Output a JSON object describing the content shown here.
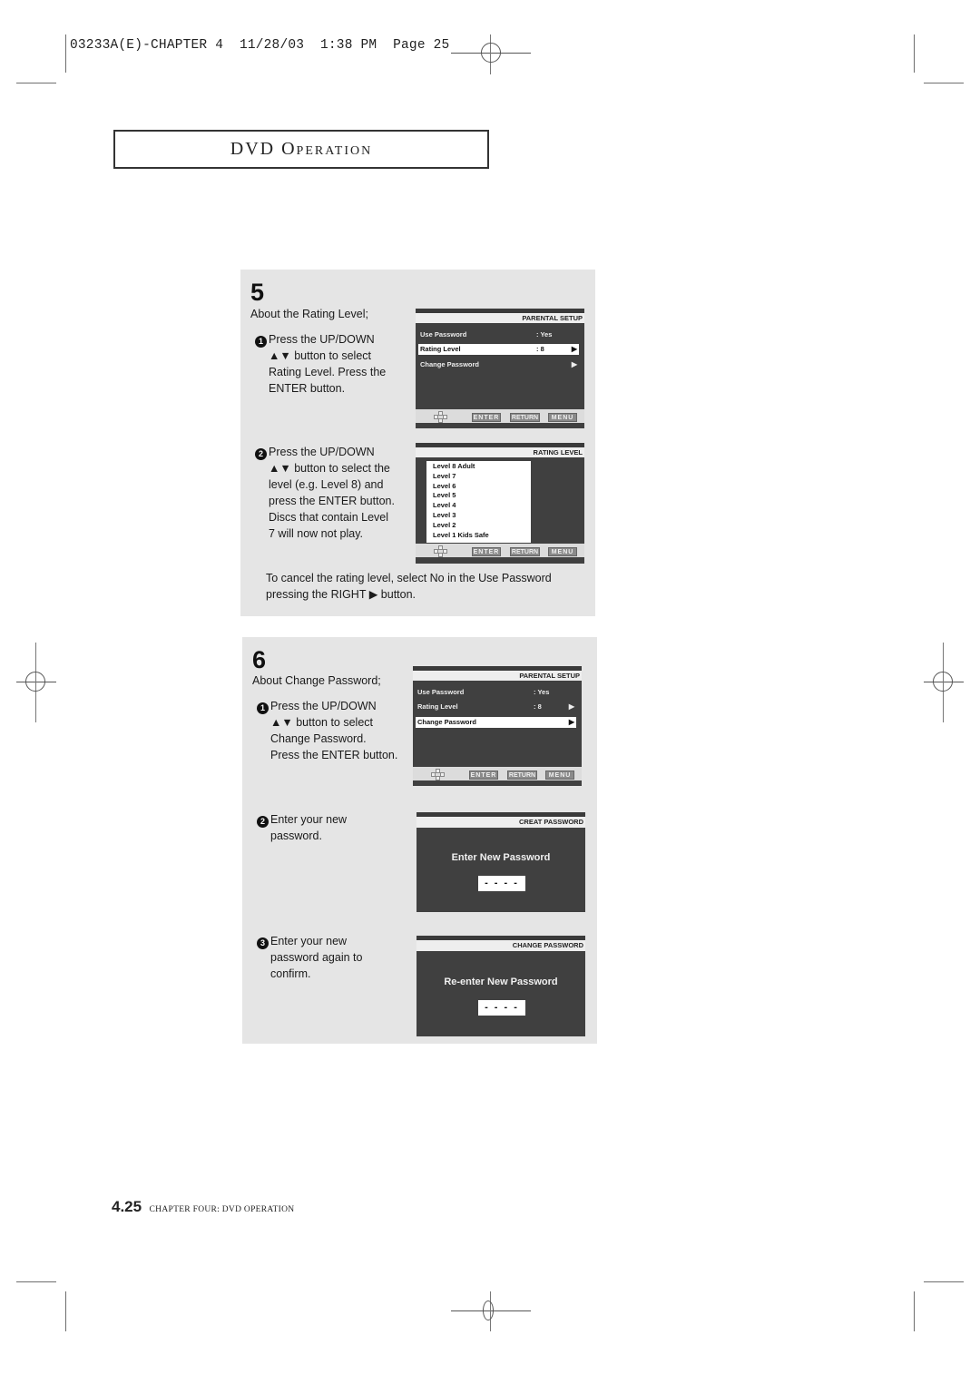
{
  "slug": {
    "job": "03233A(E)-CHAPTER 4",
    "date": "11/28/03",
    "time": "1:38 PM",
    "page_label": "Page 25"
  },
  "section_header": {
    "first": "DVD O",
    "rest": "PERATION"
  },
  "step5": {
    "number": "5",
    "intro": "About the Rating Level;",
    "instructions": [
      {
        "bullet": "1",
        "lines": [
          "Press the UP/DOWN",
          "▲▼ button to select",
          "Rating Level. Press the",
          "ENTER button."
        ]
      },
      {
        "bullet": "2",
        "lines": [
          "Press the UP/DOWN",
          "▲▼ button to select the",
          "level (e.g. Level 8) and",
          "press the ENTER button.",
          "Discs that contain Level",
          "7 will now not play."
        ]
      }
    ],
    "note_lines": [
      "To cancel the rating level, select No in the Use Password",
      "pressing the RIGHT ▶ button."
    ],
    "screen1": {
      "title": "PARENTAL SETUP",
      "rows": [
        {
          "label": "Use Password",
          "value": ": Yes",
          "arrow": ""
        },
        {
          "label": "Rating Level",
          "value": ": 8",
          "arrow": "▶"
        },
        {
          "label": "Change Password",
          "value": "",
          "arrow": "▶"
        }
      ],
      "selected_index": 1
    },
    "screen2": {
      "title": "RATING LEVEL",
      "levels": [
        "Level 8  Adult",
        "Level 7",
        "Level 6",
        "Level 5",
        "Level 4",
        "Level 3",
        "Level 2",
        "Level 1  Kids Safe"
      ]
    }
  },
  "step6": {
    "number": "6",
    "intro": "About Change Password;",
    "instructions": [
      {
        "bullet": "1",
        "lines": [
          "Press the UP/DOWN",
          "▲▼ button to select",
          "Change Password.",
          "Press the ENTER button."
        ]
      },
      {
        "bullet": "2",
        "lines": [
          "Enter your new",
          "password."
        ]
      },
      {
        "bullet": "3",
        "lines": [
          "Enter your new",
          "password again to",
          "confirm."
        ]
      }
    ],
    "screen1": {
      "title": "PARENTAL SETUP",
      "rows": [
        {
          "label": "Use Password",
          "value": ": Yes",
          "arrow": ""
        },
        {
          "label": "Rating Level",
          "value": ": 8",
          "arrow": "▶"
        },
        {
          "label": "Change Password",
          "value": "",
          "arrow": "▶"
        }
      ],
      "selected_index": 2
    },
    "screen2": {
      "title": "CREAT PASSWORD",
      "prompt": "Enter New Password",
      "value": "- - - -"
    },
    "screen3": {
      "title": "CHANGE PASSWORD",
      "prompt": "Re-enter New Password",
      "value": "- - - -"
    }
  },
  "osd_buttons": {
    "enter": "ENTER",
    "return": "RETURN",
    "menu": "MENU"
  },
  "page_footer": {
    "page_number": "4.25",
    "chapter": "CHAPTER FOUR: DVD OPERATION"
  }
}
